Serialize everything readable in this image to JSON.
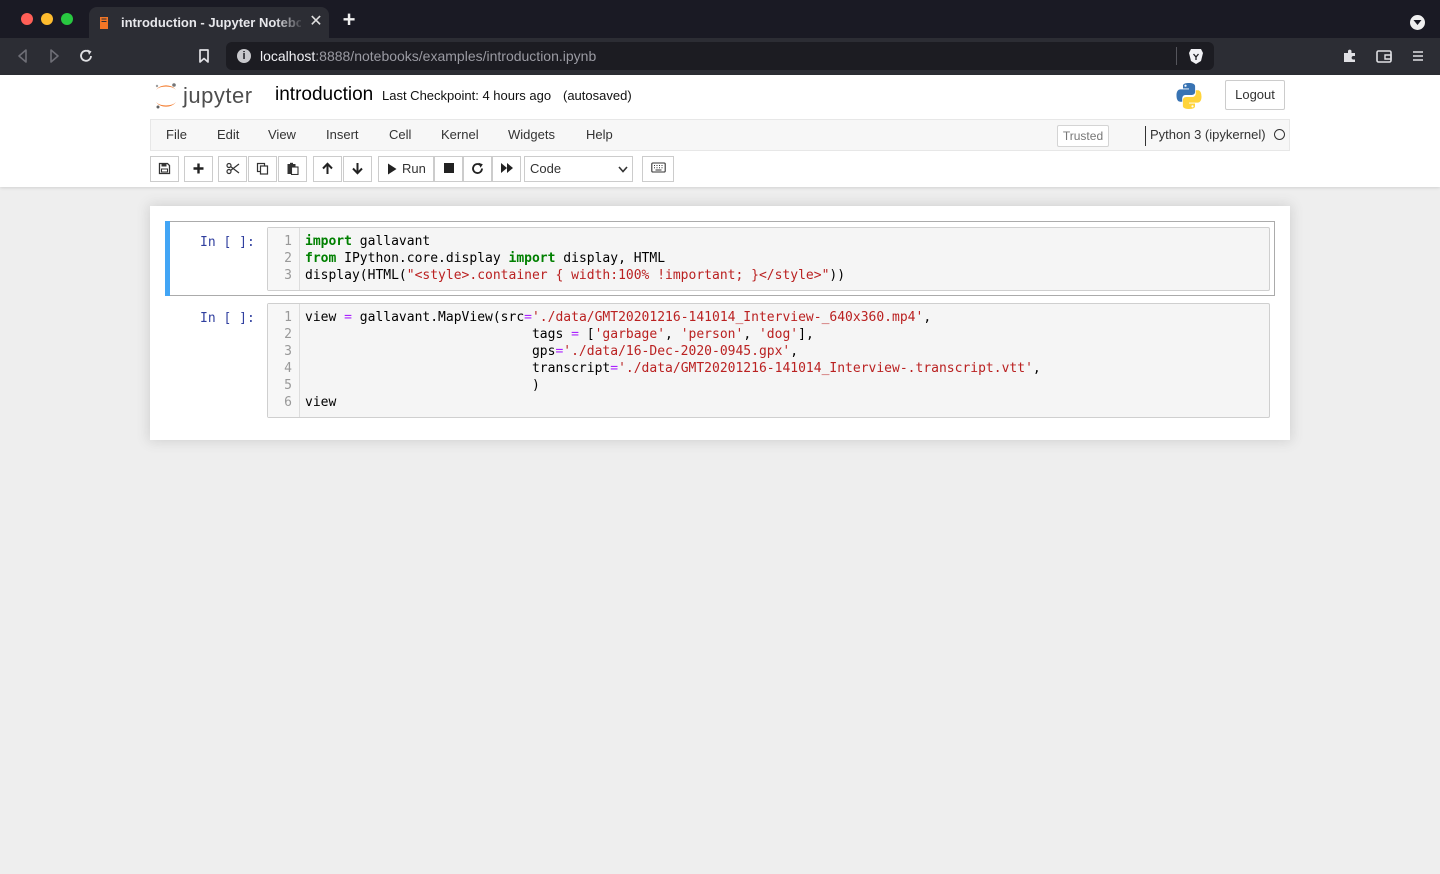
{
  "browser": {
    "tab_title": "introduction - Jupyter Notebook",
    "tab_close": "✕",
    "new_tab": "+",
    "url_host": "localhost",
    "url_path": ":8888/notebooks/examples/introduction.ipynb",
    "url_info": "i"
  },
  "header": {
    "logo_text": "jupyter",
    "notebook_name": "introduction",
    "checkpoint": "Last Checkpoint: 4 hours ago",
    "autosave": "(autosaved)",
    "logout": "Logout"
  },
  "menu": {
    "items": [
      "File",
      "Edit",
      "View",
      "Insert",
      "Cell",
      "Kernel",
      "Widgets",
      "Help"
    ],
    "trusted": "Trusted",
    "kernel": "Python 3 (ipykernel)"
  },
  "toolbar": {
    "run_label": "Run",
    "cell_type": "Code"
  },
  "cells": [
    {
      "prompt": "In [ ]:",
      "lines": [
        {
          "num": "1",
          "tokens": [
            {
              "t": "import",
              "c": "kw"
            },
            {
              "t": " gallavant",
              "c": ""
            }
          ]
        },
        {
          "num": "2",
          "tokens": [
            {
              "t": "from",
              "c": "kw"
            },
            {
              "t": " IPython.core.display ",
              "c": ""
            },
            {
              "t": "import",
              "c": "kw"
            },
            {
              "t": " display, HTML",
              "c": ""
            }
          ]
        },
        {
          "num": "3",
          "tokens": [
            {
              "t": "display(HTML(",
              "c": ""
            },
            {
              "t": "\"<style>.container { width:100% !important; }</style>\"",
              "c": "str"
            },
            {
              "t": "))",
              "c": ""
            }
          ]
        }
      ]
    },
    {
      "prompt": "In [ ]:",
      "lines": [
        {
          "num": "1",
          "tokens": [
            {
              "t": "view ",
              "c": ""
            },
            {
              "t": "=",
              "c": "op"
            },
            {
              "t": " gallavant.MapView(src",
              "c": ""
            },
            {
              "t": "=",
              "c": "op"
            },
            {
              "t": "'./data/GMT20201216-141014_Interview-_640x360.mp4'",
              "c": "str"
            },
            {
              "t": ",",
              "c": ""
            }
          ]
        },
        {
          "num": "2",
          "tokens": [
            {
              "t": "                             tags ",
              "c": ""
            },
            {
              "t": "=",
              "c": "op"
            },
            {
              "t": " [",
              "c": ""
            },
            {
              "t": "'garbage'",
              "c": "str"
            },
            {
              "t": ", ",
              "c": ""
            },
            {
              "t": "'person'",
              "c": "str"
            },
            {
              "t": ", ",
              "c": ""
            },
            {
              "t": "'dog'",
              "c": "str"
            },
            {
              "t": "],",
              "c": ""
            }
          ]
        },
        {
          "num": "3",
          "tokens": [
            {
              "t": "                             gps",
              "c": ""
            },
            {
              "t": "=",
              "c": "op"
            },
            {
              "t": "'./data/16-Dec-2020-0945.gpx'",
              "c": "str"
            },
            {
              "t": ",",
              "c": ""
            }
          ]
        },
        {
          "num": "4",
          "tokens": [
            {
              "t": "                             transcript",
              "c": ""
            },
            {
              "t": "=",
              "c": "op"
            },
            {
              "t": "'./data/GMT20201216-141014_Interview-.transcript.vtt'",
              "c": "str"
            },
            {
              "t": ",",
              "c": ""
            }
          ]
        },
        {
          "num": "5",
          "tokens": [
            {
              "t": "                             )",
              "c": ""
            }
          ]
        },
        {
          "num": "6",
          "tokens": [
            {
              "t": "view",
              "c": ""
            }
          ]
        }
      ]
    }
  ],
  "colors": {
    "keyword": "#008000",
    "string": "#ba2121",
    "operator": "#aa22ff",
    "prompt": "#303f9f",
    "selected_bar": "#42a5f5"
  }
}
